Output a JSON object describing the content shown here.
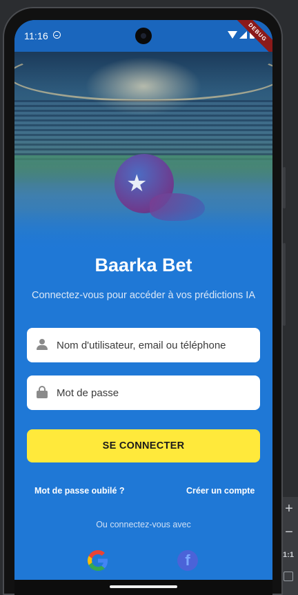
{
  "status_bar": {
    "time": "11:16",
    "debug_banner": "DEBUG",
    "icons": [
      "sync-icon",
      "wifi-icon",
      "signal-icon",
      "battery-icon"
    ]
  },
  "app": {
    "title": "Baarka Bet",
    "subtitle": "Connectez-vous pour accéder à vos prédictions IA"
  },
  "form": {
    "username_placeholder": "Nom d'utilisateur, email ou téléphone",
    "password_placeholder": "Mot de passe",
    "login_label": "SE CONNECTER"
  },
  "links": {
    "forgot_password": "Mot de passe oubilé ?",
    "create_account": "Créer un compte"
  },
  "social": {
    "or_connect_label": "Ou connectez-vous avec",
    "providers": [
      "google-icon",
      "facebook-icon"
    ]
  },
  "emulator": {
    "zoom_ratio": "1:1"
  },
  "colors": {
    "background": "#1f78d6",
    "button": "#ffe93b",
    "field": "#ffffff"
  }
}
